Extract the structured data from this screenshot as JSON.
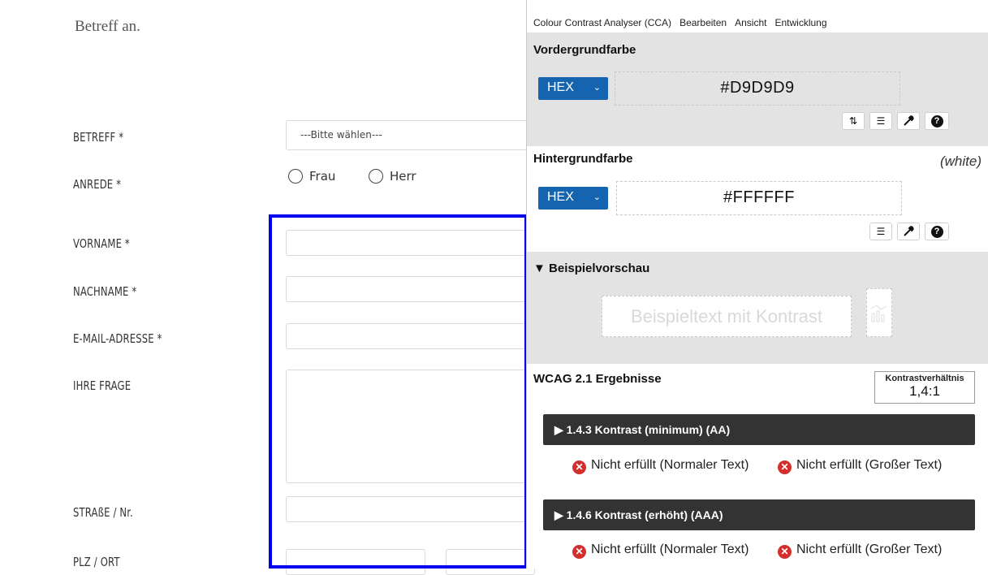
{
  "form": {
    "intro": "Betreff an.",
    "fields": {
      "betreff": "BETREFF *",
      "anrede": "ANREDE *",
      "vorname": "VORNAME *",
      "nachname": "NACHNAME *",
      "email": "E-MAIL-ADRESSE *",
      "frage": "IHRE FRAGE",
      "strasse": "STRAßE / Nr.",
      "plz": "PLZ / ORT"
    },
    "select_value": "---Bitte wählen---",
    "radio": [
      "Frau",
      "Herr"
    ]
  },
  "cca": {
    "menu": [
      "Colour Contrast Analyser (CCA)",
      "Bearbeiten",
      "Ansicht",
      "Entwicklung"
    ],
    "foreground": {
      "title": "Vordergrundfarbe",
      "format": "HEX",
      "value": "#D9D9D9"
    },
    "background": {
      "title": "Hintergrundfarbe",
      "format": "HEX",
      "value": "#FFFFFF",
      "name": "(white)"
    },
    "preview": {
      "title": "▼ Beispielvorschau",
      "sample": "Beispieltext mit Kontrast"
    },
    "results": {
      "title": "WCAG 2.1 Ergebnisse",
      "ratio_label": "Kontrastverhältnis",
      "ratio": "1,4:1",
      "criteria": [
        {
          "label": "▶ 1.4.3 Kontrast (minimum) (AA)",
          "normal": "Nicht erfüllt (Normaler Text)",
          "large": "Nicht erfüllt (Großer Text)"
        },
        {
          "label": "▶ 1.4.6 Kontrast (erhöht) (AAA)",
          "normal": "Nicht erfüllt (Normaler Text)",
          "large": "Nicht erfüllt (Großer Text)"
        }
      ]
    }
  },
  "colors": {
    "highlight": "#0000ee",
    "format_button": "#1564b0",
    "fail": "#d32f2f",
    "criterion_bar": "#333333",
    "panel_bg": "#e3e3e3"
  }
}
